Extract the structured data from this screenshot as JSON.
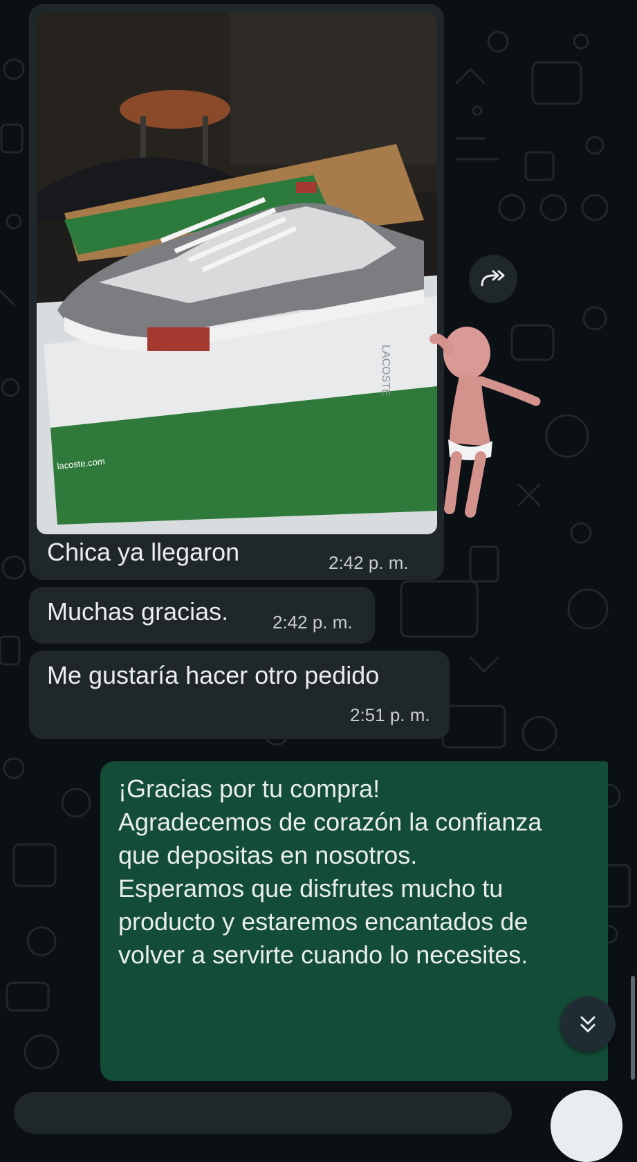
{
  "messages": [
    {
      "id": "m1",
      "direction": "in",
      "text": "Chica ya llegaron",
      "time": "2:42 p. m.",
      "has_photo": true
    },
    {
      "id": "m2",
      "direction": "in",
      "text": "Muchas gracias.",
      "time": "2:42 p. m."
    },
    {
      "id": "m3",
      "direction": "in",
      "text": "Me gustaría hacer otro pedido",
      "time": "2:51 p. m."
    },
    {
      "id": "m4",
      "direction": "out",
      "text": "¡Gracias por tu compra!\nAgradecemos de corazón la confianza que depositas en nosotros.\nEsperamos que disfrutes mucho tu producto y estaremos encantados de volver a servirte cuando lo necesites."
    }
  ],
  "photo": {
    "brand_text": "LACOSTE",
    "box_text": "lacoste.com",
    "colors": {
      "box_green": "#2f7a3a",
      "shoe_gray": "#7b7d80",
      "shoe_light": "#d9dadb",
      "accent_red": "#a3392f"
    }
  },
  "icons": {
    "forward": "forward-icon",
    "scroll_down": "double-chevron-down-icon",
    "sticker": "dancing-baby-sticker"
  },
  "colors": {
    "background": "#0b1014",
    "incoming_bubble": "#1f272a",
    "outgoing_bubble": "#144d37",
    "text": "#e9edef",
    "timestamp": "#c8cdd0"
  }
}
